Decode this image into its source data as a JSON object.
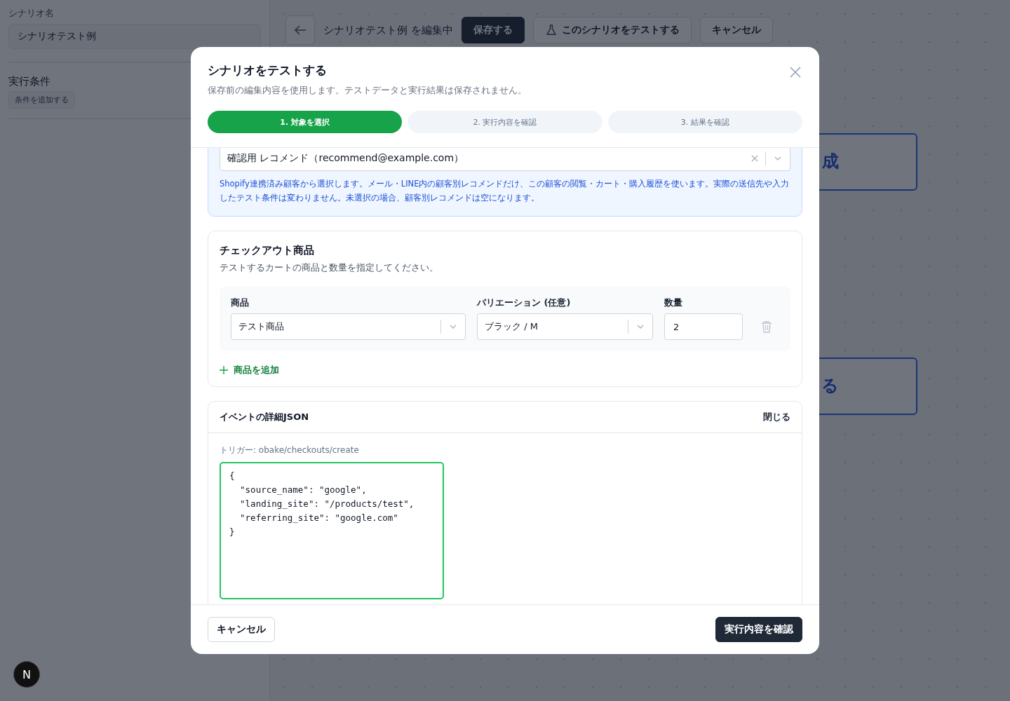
{
  "background": {
    "sidebar": {
      "name_label": "シナリオ名",
      "name_value": "シナリオテスト例",
      "conditions_title": "実行条件",
      "add_condition": "条件を追加する"
    },
    "toolbar": {
      "title": "シナリオテスト例 を編集中",
      "save": "保存する",
      "test": "このシナリオをテストする",
      "cancel": "キャンセル"
    },
    "canvas_nodes": [
      {
        "label": "成"
      },
      {
        "label": "る"
      }
    ],
    "dev_badge": "N"
  },
  "dialog": {
    "title": "シナリオをテストする",
    "subtitle": "保存前の編集内容を使用します。テストデータと実行結果は保存されません。",
    "steps": [
      {
        "label": "1. 対象を選択",
        "selected": true
      },
      {
        "label": "2. 実行内容を確認",
        "selected": false
      },
      {
        "label": "3. 結果を確認",
        "selected": false
      }
    ],
    "customer": {
      "value": "確認用 レコメンド（recommend@example.com）",
      "help": "Shopify連携済み顧客から選択します。メール・LINE内の顧客別レコメンドだけ、この顧客の閲覧・カート・購入履歴を使います。実際の送信先や入力したテスト条件は変わりません。未選択の場合、顧客別レコメンドは空になります。"
    },
    "checkout": {
      "title": "チェックアウト商品",
      "description": "テストするカートの商品と数量を指定してください。",
      "columns": [
        "商品",
        "バリエーション (任意)",
        "数量"
      ],
      "items": [
        {
          "product": "テスト商品",
          "variant": "ブラック / M",
          "quantity": "2"
        }
      ],
      "add": "商品を追加"
    },
    "event_json": {
      "title": "イベントの詳細JSON",
      "toggle": "閉じる",
      "trigger": "トリガー: obake/checkouts/create",
      "body": "{\n  \"source_name\": \"google\",\n  \"landing_site\": \"/products/test\",\n  \"referring_site\": \"google.com\"\n}"
    },
    "footer": {
      "cancel": "キャンセル",
      "confirm": "実行内容を確認"
    }
  }
}
